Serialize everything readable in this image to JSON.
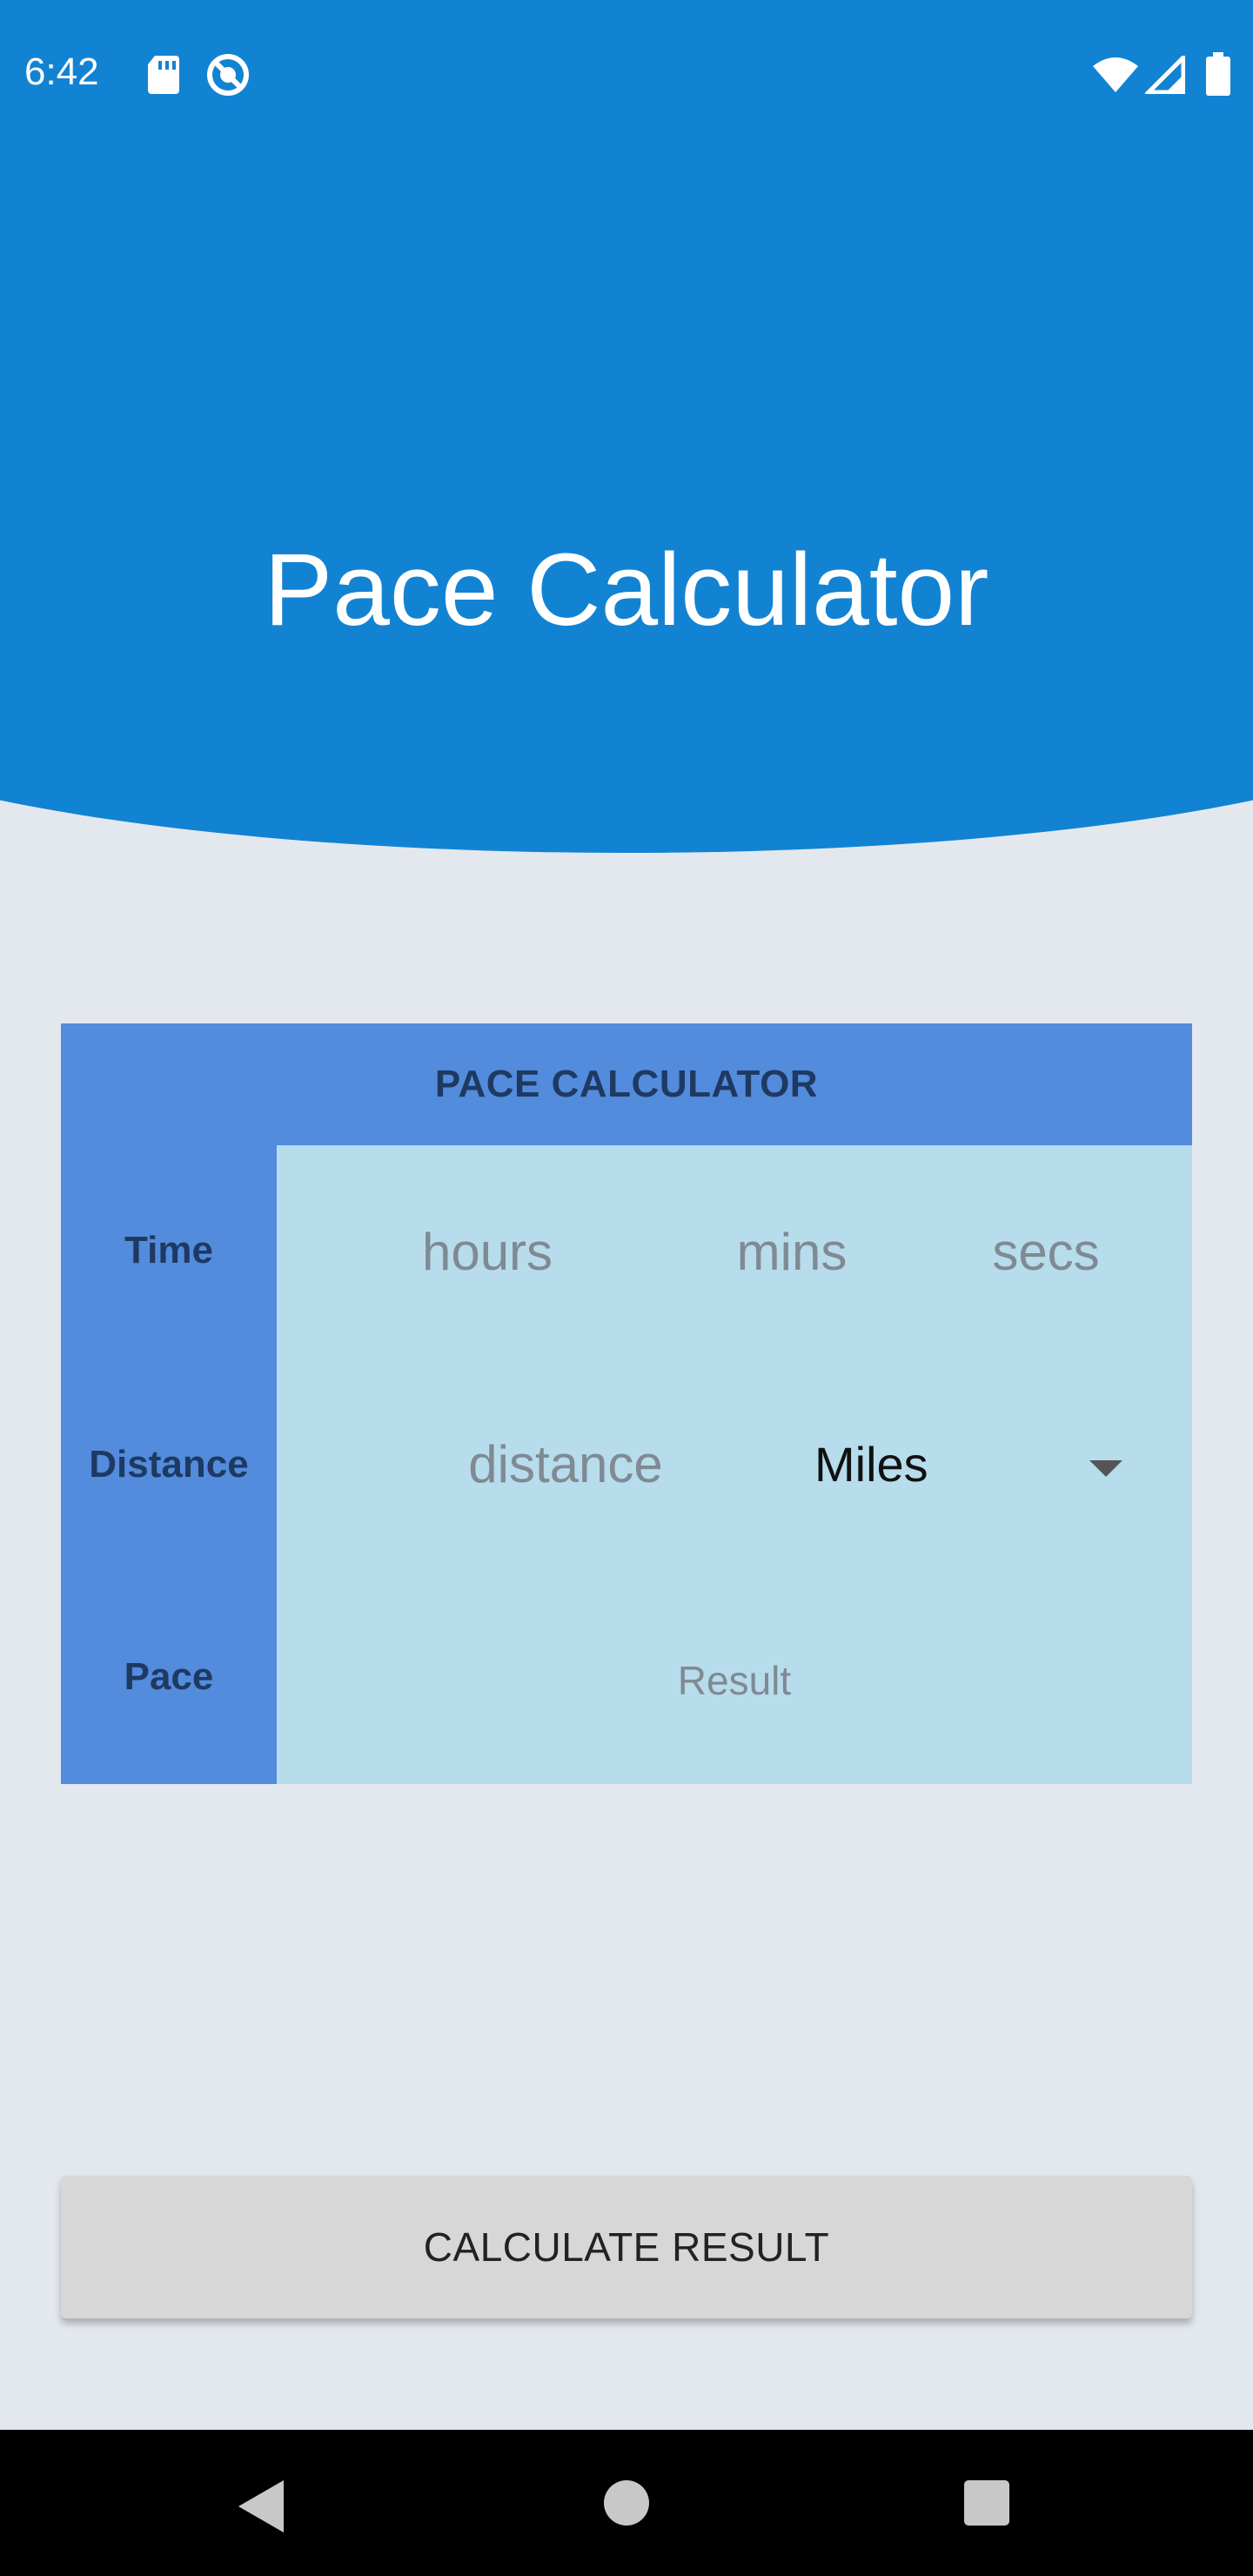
{
  "status_bar": {
    "time": "6:42",
    "icons": [
      "sd-card-icon",
      "do-not-disturb-icon",
      "wifi-icon",
      "signal-icon",
      "battery-icon"
    ]
  },
  "colors": {
    "header_blue": "#1283d3",
    "card_header_blue": "#538bdd",
    "card_body": "#b7dcec",
    "background": "#e3e8ef",
    "button_gray": "#d7d7d7"
  },
  "header": {
    "title": "Pace Calculator"
  },
  "card": {
    "title": "PACE CALCULATOR",
    "labels": {
      "time": "Time",
      "distance": "Distance",
      "pace": "Pace"
    },
    "time_fields": {
      "hours_placeholder": "hours",
      "mins_placeholder": "mins",
      "secs_placeholder": "secs"
    },
    "distance": {
      "placeholder": "distance",
      "unit_selected": "Miles"
    },
    "pace_result": "Result"
  },
  "button": {
    "calculate_label": "CALCULATE RESULT"
  },
  "nav_bar": {
    "icons": [
      "back-icon",
      "home-icon",
      "recents-icon"
    ]
  }
}
